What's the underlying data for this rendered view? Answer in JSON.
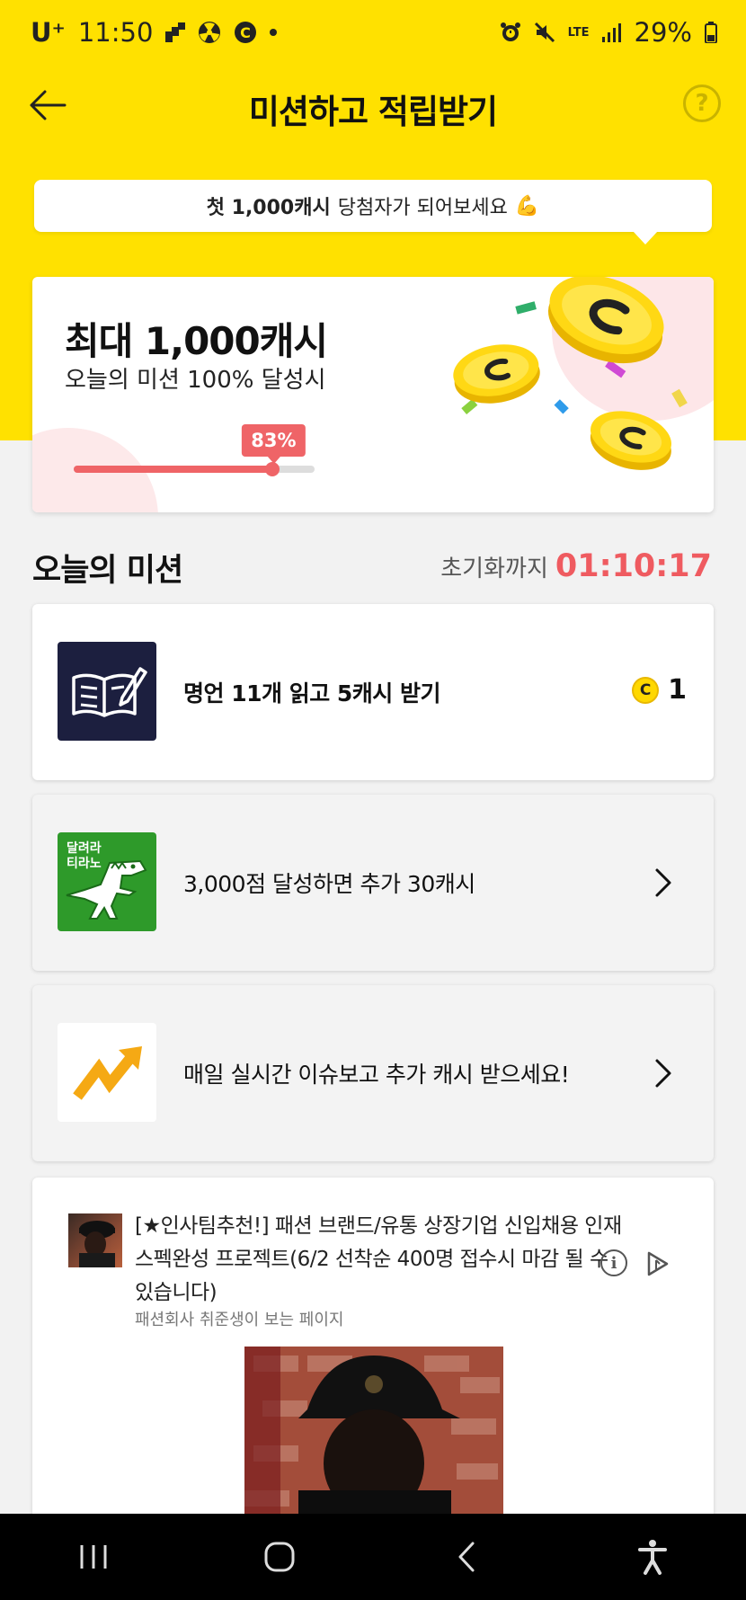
{
  "status_bar": {
    "carrier": "U⁺",
    "time": "11:50",
    "network": "LTE",
    "battery": "29%"
  },
  "header": {
    "title": "미션하고 적립받기",
    "help_label": "?"
  },
  "banner": {
    "bold_text": "첫 1,000캐시",
    "text": "당첨자가 되어보세요",
    "emoji": "💪"
  },
  "reward": {
    "title": "최대 1,000캐시",
    "subtitle": "오늘의 미션 100% 달성시",
    "progress_label": "83%",
    "progress": 0.83
  },
  "missions_section": {
    "title": "오늘의 미션",
    "reset_label": "초기화까지",
    "reset_timer": "01:10:17"
  },
  "missions": [
    {
      "text": "명언 11개 읽고 5캐시 받기",
      "coin_glyph": "C",
      "count": "1",
      "icon": "book-pen-icon"
    },
    {
      "text": "3,000점 달성하면 추가 30캐시",
      "thumb_text_line1": "달려라",
      "thumb_text_line2": "티라노",
      "icon": "dinosaur-icon"
    },
    {
      "text": "매일 실시간 이슈보고 추가 캐시 받으세요!",
      "icon": "trending-up-arrow-icon"
    }
  ],
  "ad": {
    "title_line1": "[★인사팀추천!] 패션 브랜드/유통 상장기업 신입채용 인재",
    "title_line2": "스펙완성 프로젝트(6/2 선착순 400명 접수시 마감 될 수",
    "title_line3": "있습니다)",
    "source": "패션회사 취준생이 보는 페이지",
    "info_glyph": "i"
  },
  "colors": {
    "brand_yellow": "#ffe100",
    "accent_red": "#ef5b60"
  }
}
